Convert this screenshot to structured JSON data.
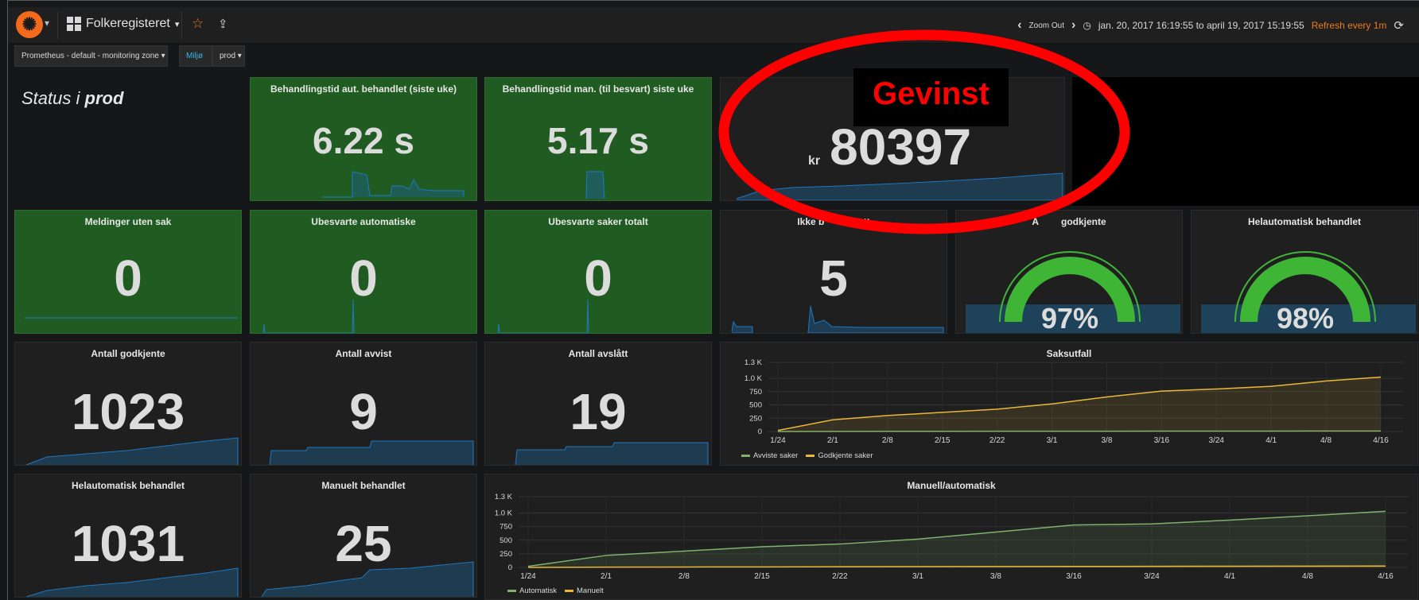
{
  "navbar": {
    "dashboard_title": "Folkeregisteret",
    "zoom_out": "Zoom Out",
    "time_range": "jan. 20, 2017 16:19:55 to april 19, 2017 15:19:55",
    "refresh": "Refresh every 1m"
  },
  "submenu": {
    "datasource": "Prometheus - default - monitoring zone",
    "miljo_label": "Miljø",
    "miljo_value": "prod"
  },
  "status": {
    "prefix": "Status i",
    "env": "prod"
  },
  "panels": {
    "aut": {
      "title": "Behandlingstid aut. behandlet (siste uke)",
      "value": "6.22 s"
    },
    "man": {
      "title": "Behandlingstid man. (til besvart) siste uke",
      "value": "5.17 s"
    },
    "gevinst": {
      "unit": "kr",
      "value": "80397"
    },
    "meldinger": {
      "title": "Meldinger uten sak",
      "value": "0"
    },
    "ubesvarte_aut": {
      "title": "Ubesvarte automatiske",
      "value": "0"
    },
    "ubesvarte_tot": {
      "title": "Ubesvarte saker totalt",
      "value": "0"
    },
    "ikke": {
      "title": "Ikke b",
      "title_tail": "tt",
      "value": "5"
    },
    "andel": {
      "title_head": "A",
      "title": "godkjente",
      "value": "97%",
      "fraction": 0.97
    },
    "helaut_gauge": {
      "title": "Helautomatisk behandlet",
      "value": "98%",
      "fraction": 0.98
    },
    "godkjente": {
      "title": "Antall godkjente",
      "value": "1023"
    },
    "avvist": {
      "title": "Antall avvist",
      "value": "9"
    },
    "avslatt": {
      "title": "Antall avslått",
      "value": "19"
    },
    "helaut_count": {
      "title": "Helautomatisk behandlet",
      "value": "1031"
    },
    "manuelt": {
      "title": "Manuelt behandlet",
      "value": "25"
    }
  },
  "annotation": {
    "text": "Gevinst"
  },
  "colors": {
    "green_panel": "#205c22",
    "orange": "#eb7b18",
    "line_yellow": "#eab839",
    "line_green": "#7eb26d",
    "spark": "#1f78c1",
    "gauge": "#3fb536",
    "annot": "#ff0000"
  },
  "chart_data": [
    {
      "type": "line",
      "title": "Saksutfall",
      "categories": [
        "1/24",
        "2/1",
        "2/8",
        "2/15",
        "2/22",
        "3/1",
        "3/8",
        "3/16",
        "3/24",
        "4/1",
        "4/8",
        "4/16"
      ],
      "y_ticks": [
        "0",
        "250",
        "500",
        "750",
        "1.0 K",
        "1.3 K"
      ],
      "ylim": [
        0,
        1300
      ],
      "series": [
        {
          "name": "Avviste saker",
          "values": [
            0,
            2,
            3,
            4,
            5,
            6,
            6,
            7,
            8,
            8,
            9,
            9
          ]
        },
        {
          "name": "Godkjente saker",
          "values": [
            20,
            220,
            300,
            360,
            420,
            520,
            650,
            760,
            800,
            850,
            950,
            1023
          ]
        }
      ],
      "legend": "bottom-left"
    },
    {
      "type": "line",
      "title": "Manuell/automatisk",
      "categories": [
        "1/24",
        "2/1",
        "2/8",
        "2/15",
        "2/22",
        "3/1",
        "3/8",
        "3/16",
        "3/24",
        "4/1",
        "4/8",
        "4/16"
      ],
      "y_ticks": [
        "0",
        "250",
        "500",
        "750",
        "1.0 K",
        "1.3 K"
      ],
      "ylim": [
        0,
        1300
      ],
      "series": [
        {
          "name": "Automatisk",
          "values": [
            20,
            220,
            300,
            380,
            430,
            520,
            650,
            780,
            800,
            870,
            950,
            1031
          ]
        },
        {
          "name": "Manuelt",
          "values": [
            0,
            5,
            8,
            10,
            12,
            14,
            16,
            18,
            20,
            22,
            24,
            25
          ]
        }
      ],
      "legend": "bottom-left"
    }
  ]
}
